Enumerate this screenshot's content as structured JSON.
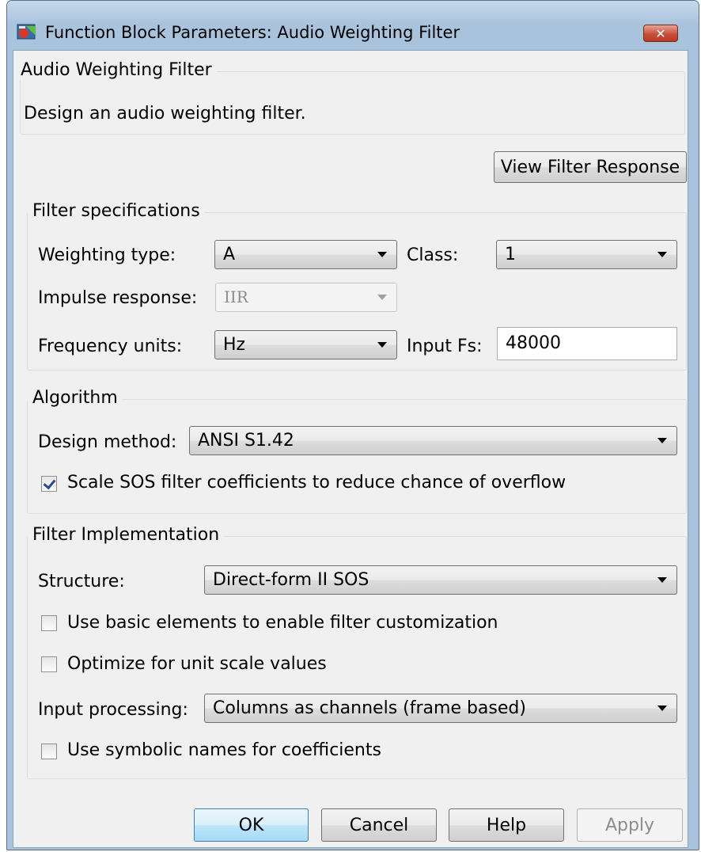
{
  "window": {
    "title": "Function Block Parameters: Audio Weighting Filter",
    "close_label": "✕"
  },
  "header": {
    "group_title": "Audio Weighting Filter",
    "description": "Design an audio weighting filter."
  },
  "view_filter_response_label": "View Filter Response",
  "filter_specs": {
    "group_title": "Filter specifications",
    "weighting_type_label": "Weighting type:",
    "weighting_type_value": "A",
    "class_label": "Class:",
    "class_value": "1",
    "impulse_response_label": "Impulse response:",
    "impulse_response_value": "IIR",
    "frequency_units_label": "Frequency units:",
    "frequency_units_value": "Hz",
    "input_fs_label": "Input Fs:",
    "input_fs_value": "48000"
  },
  "algorithm": {
    "group_title": "Algorithm",
    "design_method_label": "Design method:",
    "design_method_value": "ANSI S1.42",
    "scale_sos_label": "Scale SOS filter coefficients to reduce chance of overflow",
    "scale_sos_checked": true
  },
  "implementation": {
    "group_title": "Filter Implementation",
    "structure_label": "Structure:",
    "structure_value": "Direct-form II SOS",
    "basic_elements_label": "Use basic elements to enable filter customization",
    "basic_elements_checked": false,
    "optimize_label": "Optimize for unit scale values",
    "optimize_checked": false,
    "input_processing_label": "Input processing:",
    "input_processing_value": "Columns as channels (frame based)",
    "symbolic_names_label": "Use symbolic names for coefficients",
    "symbolic_names_checked": false
  },
  "footer": {
    "ok_label": "OK",
    "cancel_label": "Cancel",
    "help_label": "Help",
    "apply_label": "Apply"
  }
}
